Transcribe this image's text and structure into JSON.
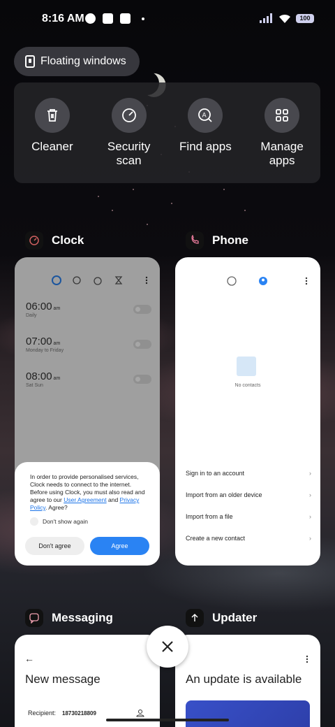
{
  "status_bar": {
    "time": "8:16 AM",
    "battery": "100"
  },
  "floating_windows": {
    "label": "Floating windows"
  },
  "tools": [
    {
      "label": "Cleaner",
      "icon": "trash-icon"
    },
    {
      "label": "Security scan",
      "icon": "gauge-icon"
    },
    {
      "label": "Find apps",
      "icon": "search-apps-icon"
    },
    {
      "label": "Manage apps",
      "icon": "grid-icon"
    }
  ],
  "clock": {
    "title": "Clock",
    "alarms": [
      {
        "time": "06:00",
        "ampm": "am",
        "days": "Daily"
      },
      {
        "time": "07:00",
        "ampm": "am",
        "days": "Monday to Friday"
      },
      {
        "time": "08:00",
        "ampm": "am",
        "days": "Sat Sun"
      }
    ],
    "consent_text_1": "In order to provide personalised services, Clock needs to connect to the internet. Before using Clock, you must also read and agree to our ",
    "consent_link_1": "User Agreement",
    "consent_and": " and ",
    "consent_link_2": "Privacy Policy",
    "consent_end": ". Agree?",
    "dont_show": "Don't show again",
    "dont_agree": "Don't agree",
    "agree": "Agree"
  },
  "phone": {
    "title": "Phone",
    "no_contacts": "No contacts",
    "rows": [
      "Sign in to an account",
      "Import from an older device",
      "Import from a file",
      "Create a new contact"
    ]
  },
  "messaging": {
    "title": "Messaging",
    "new_message": "New message",
    "recipient_label": "Recipient:",
    "recipient_value": "18730218809"
  },
  "updater": {
    "title": "Updater",
    "update_text": "An update is available"
  },
  "colors": {
    "accent_blue": "#2a83f3",
    "card_bg": "#ffffff"
  }
}
